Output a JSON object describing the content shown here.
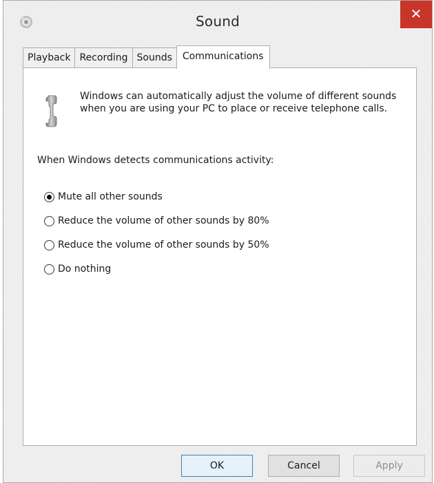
{
  "window": {
    "title": "Sound",
    "close_glyph": "✕"
  },
  "tabs": [
    {
      "label": "Playback",
      "active": false
    },
    {
      "label": "Recording",
      "active": false
    },
    {
      "label": "Sounds",
      "active": false
    },
    {
      "label": "Communications",
      "active": true
    }
  ],
  "communications": {
    "intro_text": "Windows can automatically adjust the volume of different sounds when you are using your PC to place or receive telephone calls.",
    "detect_label": "When Windows detects communications activity:",
    "options": [
      {
        "label": "Mute all other sounds",
        "selected": true
      },
      {
        "label": "Reduce the volume of other sounds by 80%",
        "selected": false
      },
      {
        "label": "Reduce the volume of other sounds by 50%",
        "selected": false
      },
      {
        "label": "Do nothing",
        "selected": false
      }
    ]
  },
  "buttons": {
    "ok": "OK",
    "cancel": "Cancel",
    "apply": "Apply"
  },
  "icons": {
    "app": "speaker-icon",
    "phone": "telephone-handset-icon",
    "close": "close-icon"
  },
  "colors": {
    "close_button": "#c7352b",
    "window_bg": "#f0f0f0",
    "panel_bg": "#ffffff",
    "default_button_border": "#3c7fb1"
  }
}
